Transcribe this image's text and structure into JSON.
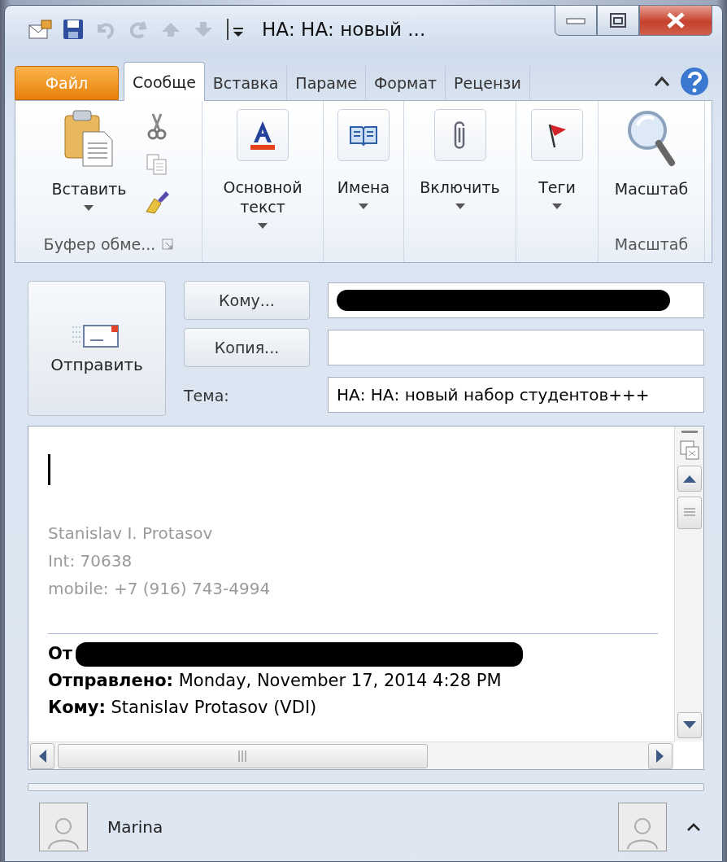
{
  "window": {
    "title": "НА: НА: новый ..."
  },
  "quick_access": [
    {
      "kind": "mail",
      "disabled": false
    },
    {
      "kind": "save",
      "disabled": false
    },
    {
      "kind": "undo",
      "disabled": true
    },
    {
      "kind": "redo",
      "disabled": true
    },
    {
      "kind": "up",
      "disabled": true
    },
    {
      "kind": "down",
      "disabled": true
    },
    {
      "kind": "customize",
      "disabled": false
    }
  ],
  "tabs": [
    {
      "label": "Файл",
      "kind": "file",
      "selected": false
    },
    {
      "label": "Сообще",
      "kind": "tab",
      "selected": true
    },
    {
      "label": "Вставка",
      "kind": "tab",
      "selected": false
    },
    {
      "label": "Параме",
      "kind": "tab",
      "selected": false
    },
    {
      "label": "Формат",
      "kind": "tab",
      "selected": false
    },
    {
      "label": "Рецензи",
      "kind": "tab",
      "selected": false
    }
  ],
  "ribbon": {
    "groups": [
      {
        "kind": "paste",
        "button": "Вставить",
        "dropdown": true,
        "label": "Буфер обме..."
      },
      {
        "kind": "font",
        "button": "Основной текст",
        "dropdown": true
      },
      {
        "kind": "names",
        "button": "Имена",
        "dropdown": true
      },
      {
        "kind": "attach",
        "button": "Включить",
        "dropdown": true
      },
      {
        "kind": "tags",
        "button": "Теги",
        "dropdown": true
      },
      {
        "kind": "zoom",
        "button": "Масштаб",
        "dropdown": false,
        "label": "Масштаб"
      }
    ]
  },
  "compose": {
    "send_button": "Отправить",
    "to": {
      "button": "Кому...",
      "redacted": true
    },
    "cc": {
      "button": "Копия..."
    },
    "subject": {
      "label": "Тема:",
      "value": "НА: НА: новый набор студентов+++"
    }
  },
  "body": {
    "signature": [
      "Stanislav I. Protasov",
      "Int: 70638",
      "mobile: +7 (916) 743-4994"
    ],
    "header": [
      {
        "text": "**От**",
        "redacted": true
      },
      {
        "text": "**Отправлено:** Monday, November 17, 2014 4:28 PM",
        "redacted": false
      },
      {
        "text": "**Кому:** Stanislav Protasov (VDI)",
        "redacted": false
      }
    ]
  },
  "people": [
    {
      "name": "Marina"
    }
  ]
}
